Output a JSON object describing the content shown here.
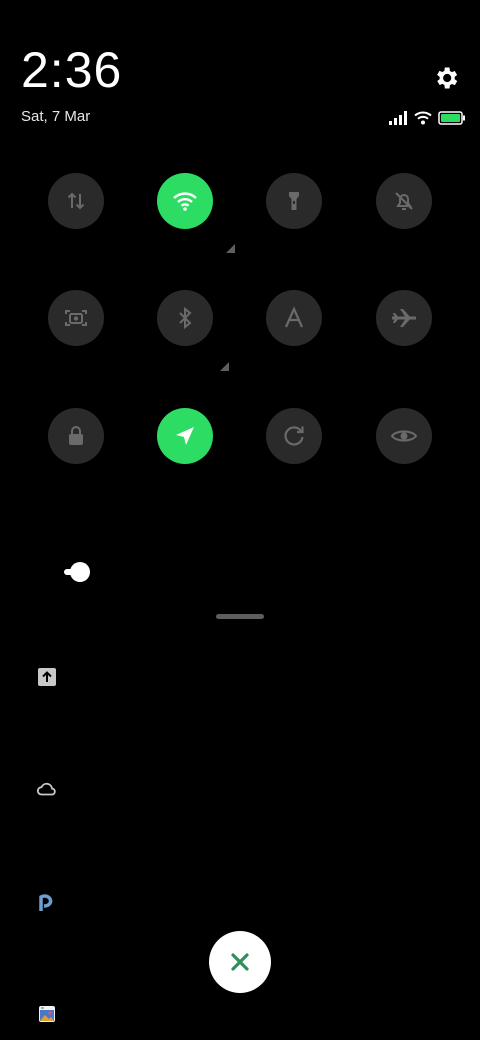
{
  "header": {
    "time": "2:36",
    "date": "Sat, 7 Mar"
  },
  "status_bar": {
    "icons": [
      "signal-icon",
      "wifi-icon",
      "battery-icon"
    ],
    "battery_color": "#2ddc62"
  },
  "quick_settings": {
    "accent_color": "#2ddc62",
    "tiles": [
      {
        "name": "mobile-data",
        "icon": "data-arrows-icon",
        "active": false
      },
      {
        "name": "wifi",
        "icon": "wifi-icon",
        "active": true
      },
      {
        "name": "flashlight",
        "icon": "flashlight-icon",
        "active": false
      },
      {
        "name": "mute",
        "icon": "bell-off-icon",
        "active": false
      },
      {
        "name": "screenshot",
        "icon": "camera-icon",
        "active": false
      },
      {
        "name": "bluetooth",
        "icon": "bluetooth-icon",
        "active": false
      },
      {
        "name": "auto-brightness",
        "icon": "letter-a-icon",
        "active": false
      },
      {
        "name": "airplane-mode",
        "icon": "airplane-icon",
        "active": false
      },
      {
        "name": "lock-screen",
        "icon": "lock-icon",
        "active": false
      },
      {
        "name": "location",
        "icon": "navigation-arrow-icon",
        "active": true
      },
      {
        "name": "auto-rotate",
        "icon": "rotate-icon",
        "active": false
      },
      {
        "name": "reading-mode",
        "icon": "eye-icon",
        "active": false
      }
    ]
  },
  "brightness": {
    "level": 0.05
  },
  "notifications": {
    "app_icons": [
      "upload-icon",
      "cloud-icon",
      "p-app-icon",
      "gallery-icon"
    ]
  },
  "clear_button": {
    "icon": "close-icon"
  }
}
